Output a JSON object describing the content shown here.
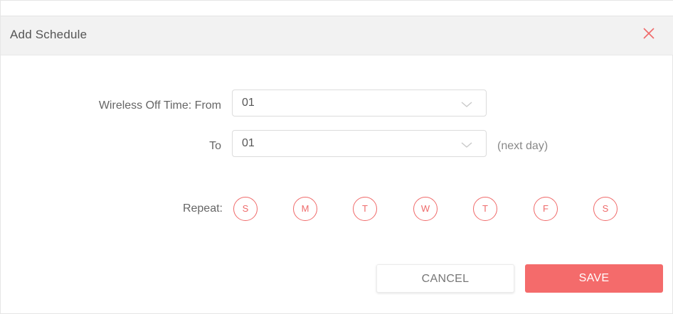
{
  "dialog": {
    "title": "Add Schedule",
    "close_icon": "close-icon"
  },
  "form": {
    "off_time_label": "Wireless Off Time: From",
    "from_value": "01",
    "to_label": "To",
    "to_value": "01",
    "next_day_hint": "(next day)",
    "repeat_label": "Repeat:",
    "days": [
      "S",
      "M",
      "T",
      "W",
      "T",
      "F",
      "S"
    ]
  },
  "buttons": {
    "cancel": "CANCEL",
    "save": "SAVE"
  },
  "colors": {
    "accent": "#f46b6b",
    "title_bar": "#f2f2f2"
  }
}
